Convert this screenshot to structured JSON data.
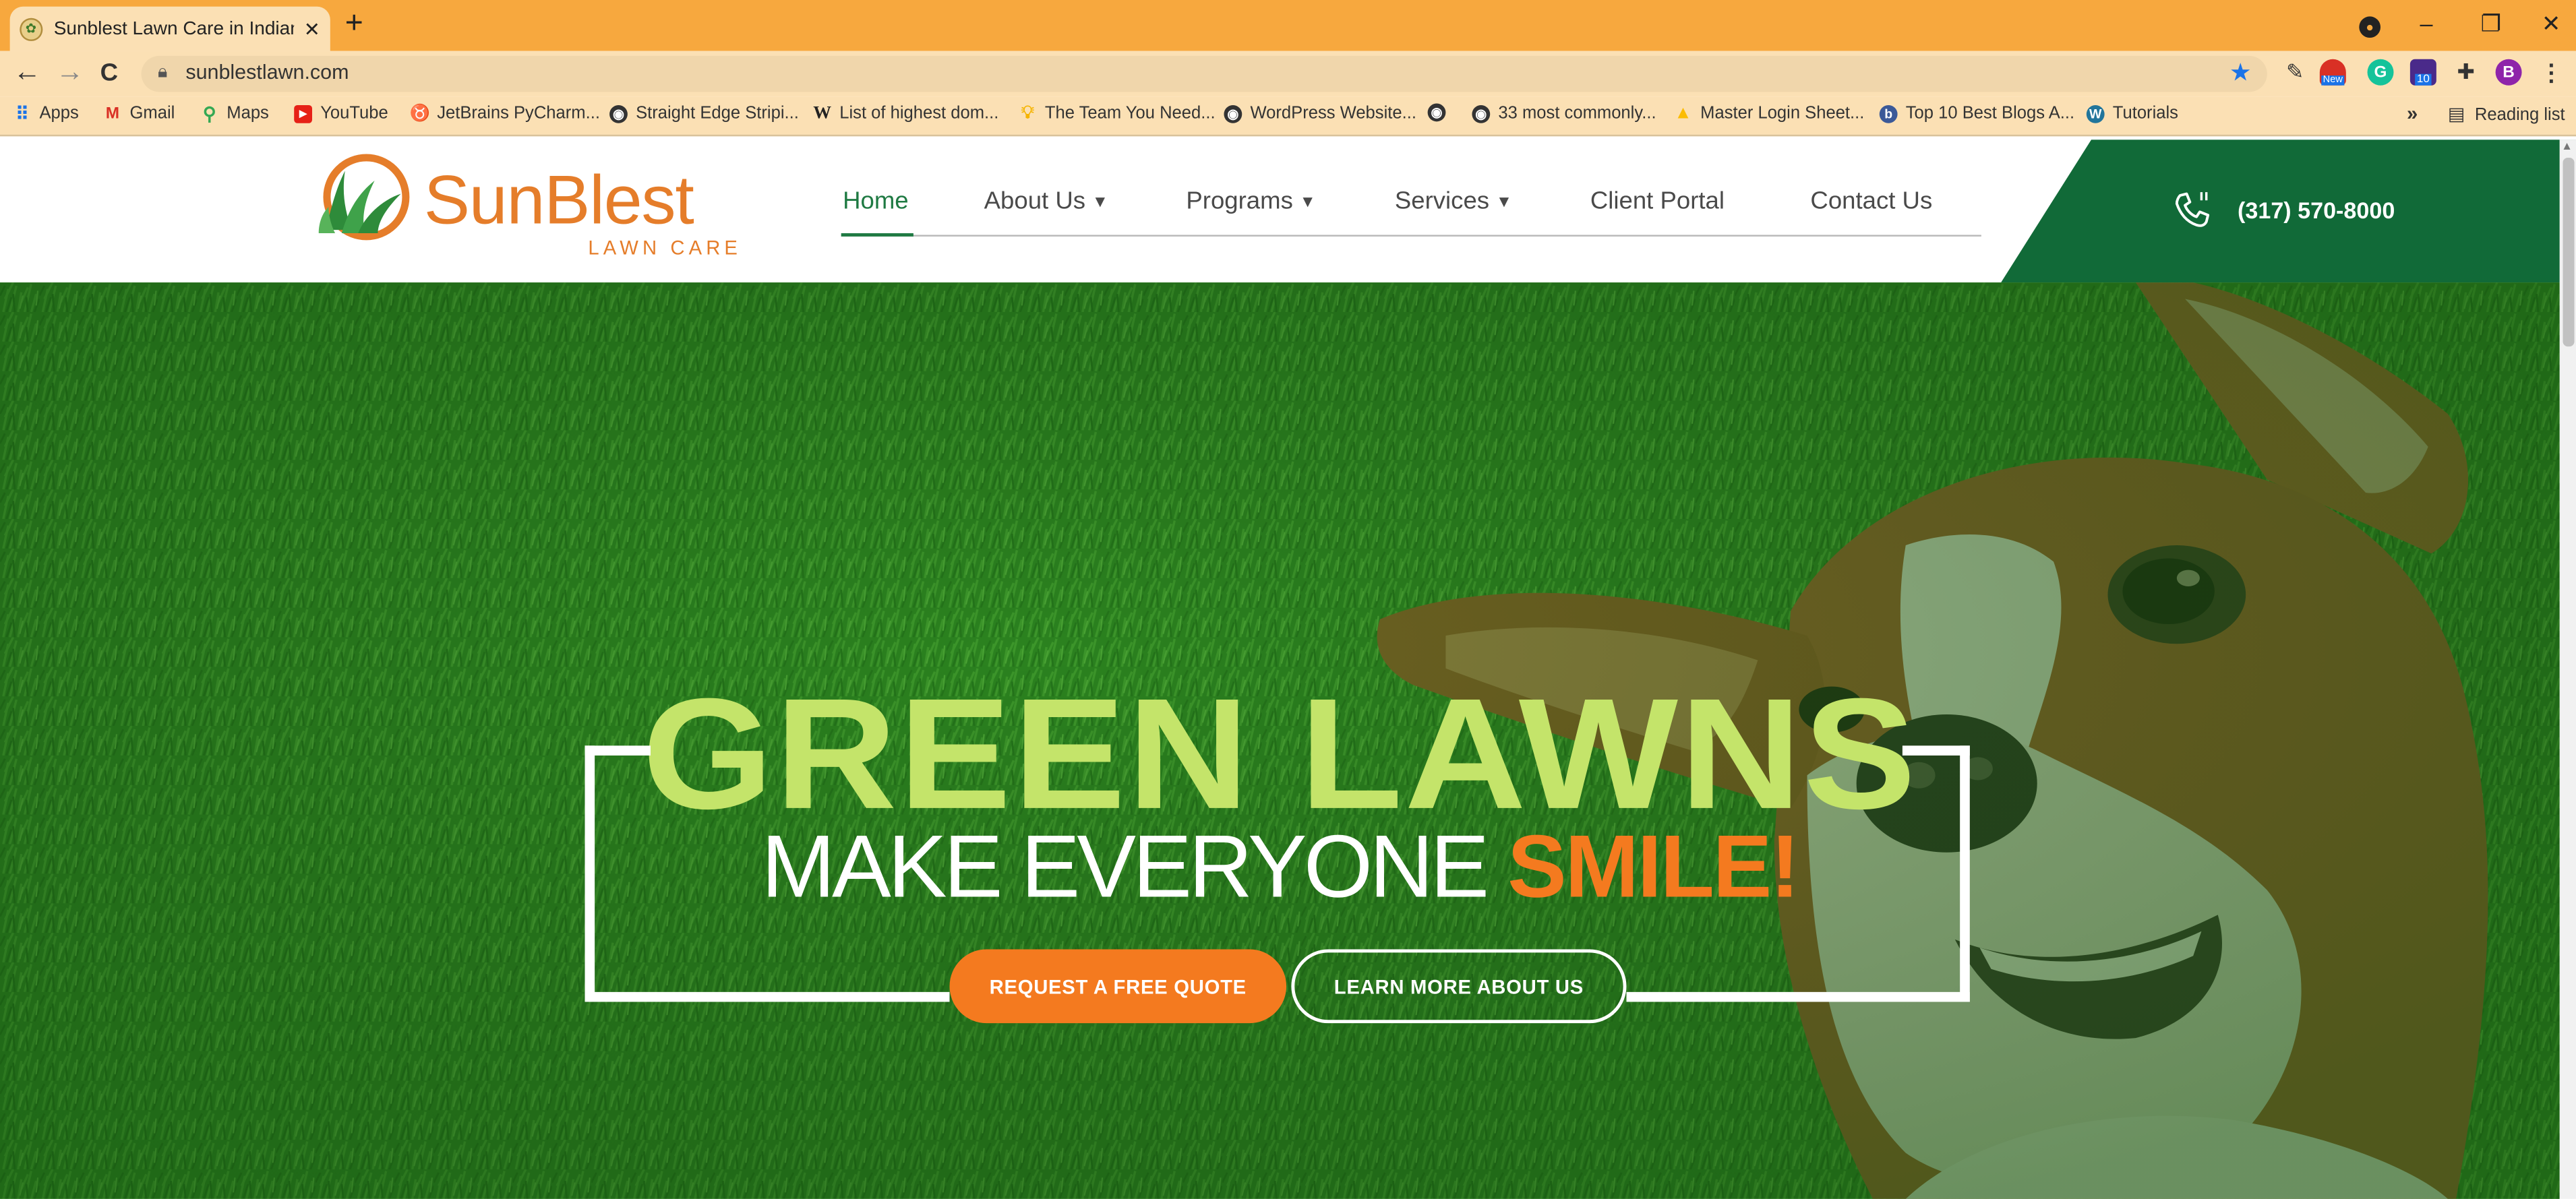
{
  "browser": {
    "tab_title": "Sunblest Lawn Care in Indianapo",
    "tab_close": "✕",
    "new_tab": "+",
    "url": "sunblestlawn.com",
    "profile_initial": "B",
    "window_controls": {
      "minimize": "–",
      "restore": "❐",
      "close": "✕"
    },
    "nav": {
      "back": "←",
      "forward": "→",
      "reload": "C"
    },
    "extensions": [
      "pencil-icon",
      "new-badge-icon",
      "grammarly-icon",
      "extension-badge-icon",
      "puzzle-icon"
    ],
    "extension_badges": {
      "new": "New",
      "count": "10"
    }
  },
  "bookmarks": [
    {
      "label": "Apps",
      "icon": "apps-grid-icon"
    },
    {
      "label": "Gmail",
      "icon": "gmail-icon"
    },
    {
      "label": "Maps",
      "icon": "maps-icon"
    },
    {
      "label": "YouTube",
      "icon": "youtube-icon"
    },
    {
      "label": "JetBrains PyCharm...",
      "icon": "jetbrains-icon"
    },
    {
      "label": "Straight Edge Stripi...",
      "icon": "globe-icon"
    },
    {
      "label": "List of highest dom...",
      "icon": "wikipedia-icon"
    },
    {
      "label": "The Team You Need...",
      "icon": "lightbulb-icon"
    },
    {
      "label": "WordPress Website...",
      "icon": "globe-icon"
    },
    {
      "label": "",
      "icon": "globe-icon"
    },
    {
      "label": "33 most commonly...",
      "icon": "globe-icon"
    },
    {
      "label": "Master Login Sheet...",
      "icon": "drive-icon"
    },
    {
      "label": "Top 10 Best Blogs A...",
      "icon": "blog-icon"
    },
    {
      "label": "Tutorials",
      "icon": "wordpress-icon"
    }
  ],
  "bookmarks_more": "»",
  "reading_list": "Reading list",
  "site": {
    "logo_main": "SunBlest",
    "logo_sub": "LAWN CARE",
    "nav": [
      {
        "label": "Home",
        "dropdown": false,
        "active": true
      },
      {
        "label": "About Us",
        "dropdown": true,
        "active": false
      },
      {
        "label": "Programs",
        "dropdown": true,
        "active": false
      },
      {
        "label": "Services",
        "dropdown": true,
        "active": false
      },
      {
        "label": "Client Portal",
        "dropdown": false,
        "active": false
      },
      {
        "label": "Contact Us",
        "dropdown": false,
        "active": false
      }
    ],
    "phone": "(317) 570-8000"
  },
  "hero": {
    "title": "GREEN LAWNS",
    "subtitle_main": "MAKE EVERYONE ",
    "subtitle_accent": "SMILE!",
    "cta_primary": "REQUEST A FREE QUOTE",
    "cta_secondary": "LEARN MORE ABOUT US"
  },
  "colors": {
    "browser_accent": "#f7a83e",
    "brand_green": "#116a38",
    "brand_orange": "#e57d2a",
    "hero_title": "#c4e46a",
    "cta_orange": "#f47a1f"
  }
}
